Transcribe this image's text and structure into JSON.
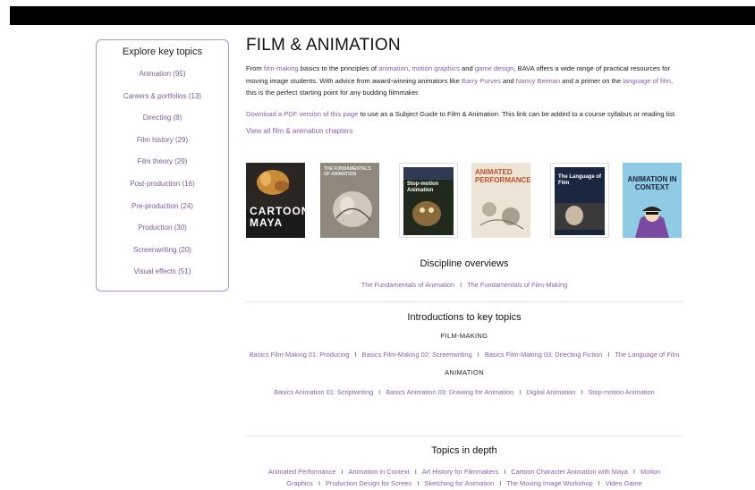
{
  "sidebar": {
    "heading": "Explore key topics",
    "items": [
      "Animation (95)",
      "Careers & portfolios (13)",
      "Directing (8)",
      "Film history (29)",
      "Film theory (29)",
      "Post-production (16)",
      "Pre-production (24)",
      "Production (30)",
      "Screenwriting (20)",
      "Visual effects (51)"
    ]
  },
  "main": {
    "title": "FILM & ANIMATION",
    "intro": {
      "t1": "From ",
      "l1": "film-making",
      "t2": " basics to the principles of ",
      "l2": "animation",
      "t3": ", ",
      "l3": "motion graphics",
      "t4": " and ",
      "l4": "game design",
      "t5": ", BAVA offers a wide range of practical resources for moving image students. With advice from award-winning animators like ",
      "l5": "Barry Purves",
      "t6": " and ",
      "l6": "Nancy Beiman",
      "t7": " and a primer on the ",
      "l7": "language of film",
      "t8": ", this is the perfect starting point for any budding filmmaker."
    },
    "pdf": {
      "link": "Download a PDF version of this page",
      "text": " to use as a Subject Guide to Film & Animation. This link can be added to a course syllabus or reading list."
    },
    "view_all": "View all film & animation chapters",
    "covers": [
      {
        "title": "CARTOON MAYA",
        "bg": "#2a2a2a"
      },
      {
        "title": "THE FUNDAMENTALS OF ANIMATION",
        "bg": "#8c8479"
      },
      {
        "title": "Stop-motion Animation",
        "bg": "#1f2a1d"
      },
      {
        "title": "ANIMATED PERFORMANCE",
        "bg": "#efe6d6"
      },
      {
        "title": "The Language of Film",
        "bg": "#1a2740"
      },
      {
        "title": "ANIMATION IN CONTEXT",
        "bg": "#8fc9e3"
      }
    ],
    "discipline": {
      "heading": "Discipline overviews",
      "links": [
        "The Fundamentals of Animation",
        "The Fundamentals of Film-Making"
      ]
    },
    "intros": {
      "heading": "Introductions to key topics",
      "filmmaking_label": "FILM-MAKING",
      "filmmaking_links": [
        "Basics Film-Making 01: Producing",
        "Basics Film-Making 02: Screenwriting",
        "Basics Film-Making 03: Directing Fiction",
        "The Language of Film"
      ],
      "animation_label": "ANIMATION",
      "animation_links": [
        "Basics Animation 01: Scriptwriting",
        "Basics Animation 03: Drawing for Animation",
        "Digital Animation",
        "Stop-motion Animation"
      ]
    },
    "depth": {
      "heading": "Topics in depth",
      "links": [
        "Animated Performance",
        "Animation in Context",
        "Art History for Filmmakers",
        "Cartoon Character Animation with Maya",
        "Motion Graphics",
        "Production Design for Screen",
        "Sketching for Animation",
        "The Moving Image Workshop",
        "Video Game"
      ]
    },
    "separator": "I"
  }
}
